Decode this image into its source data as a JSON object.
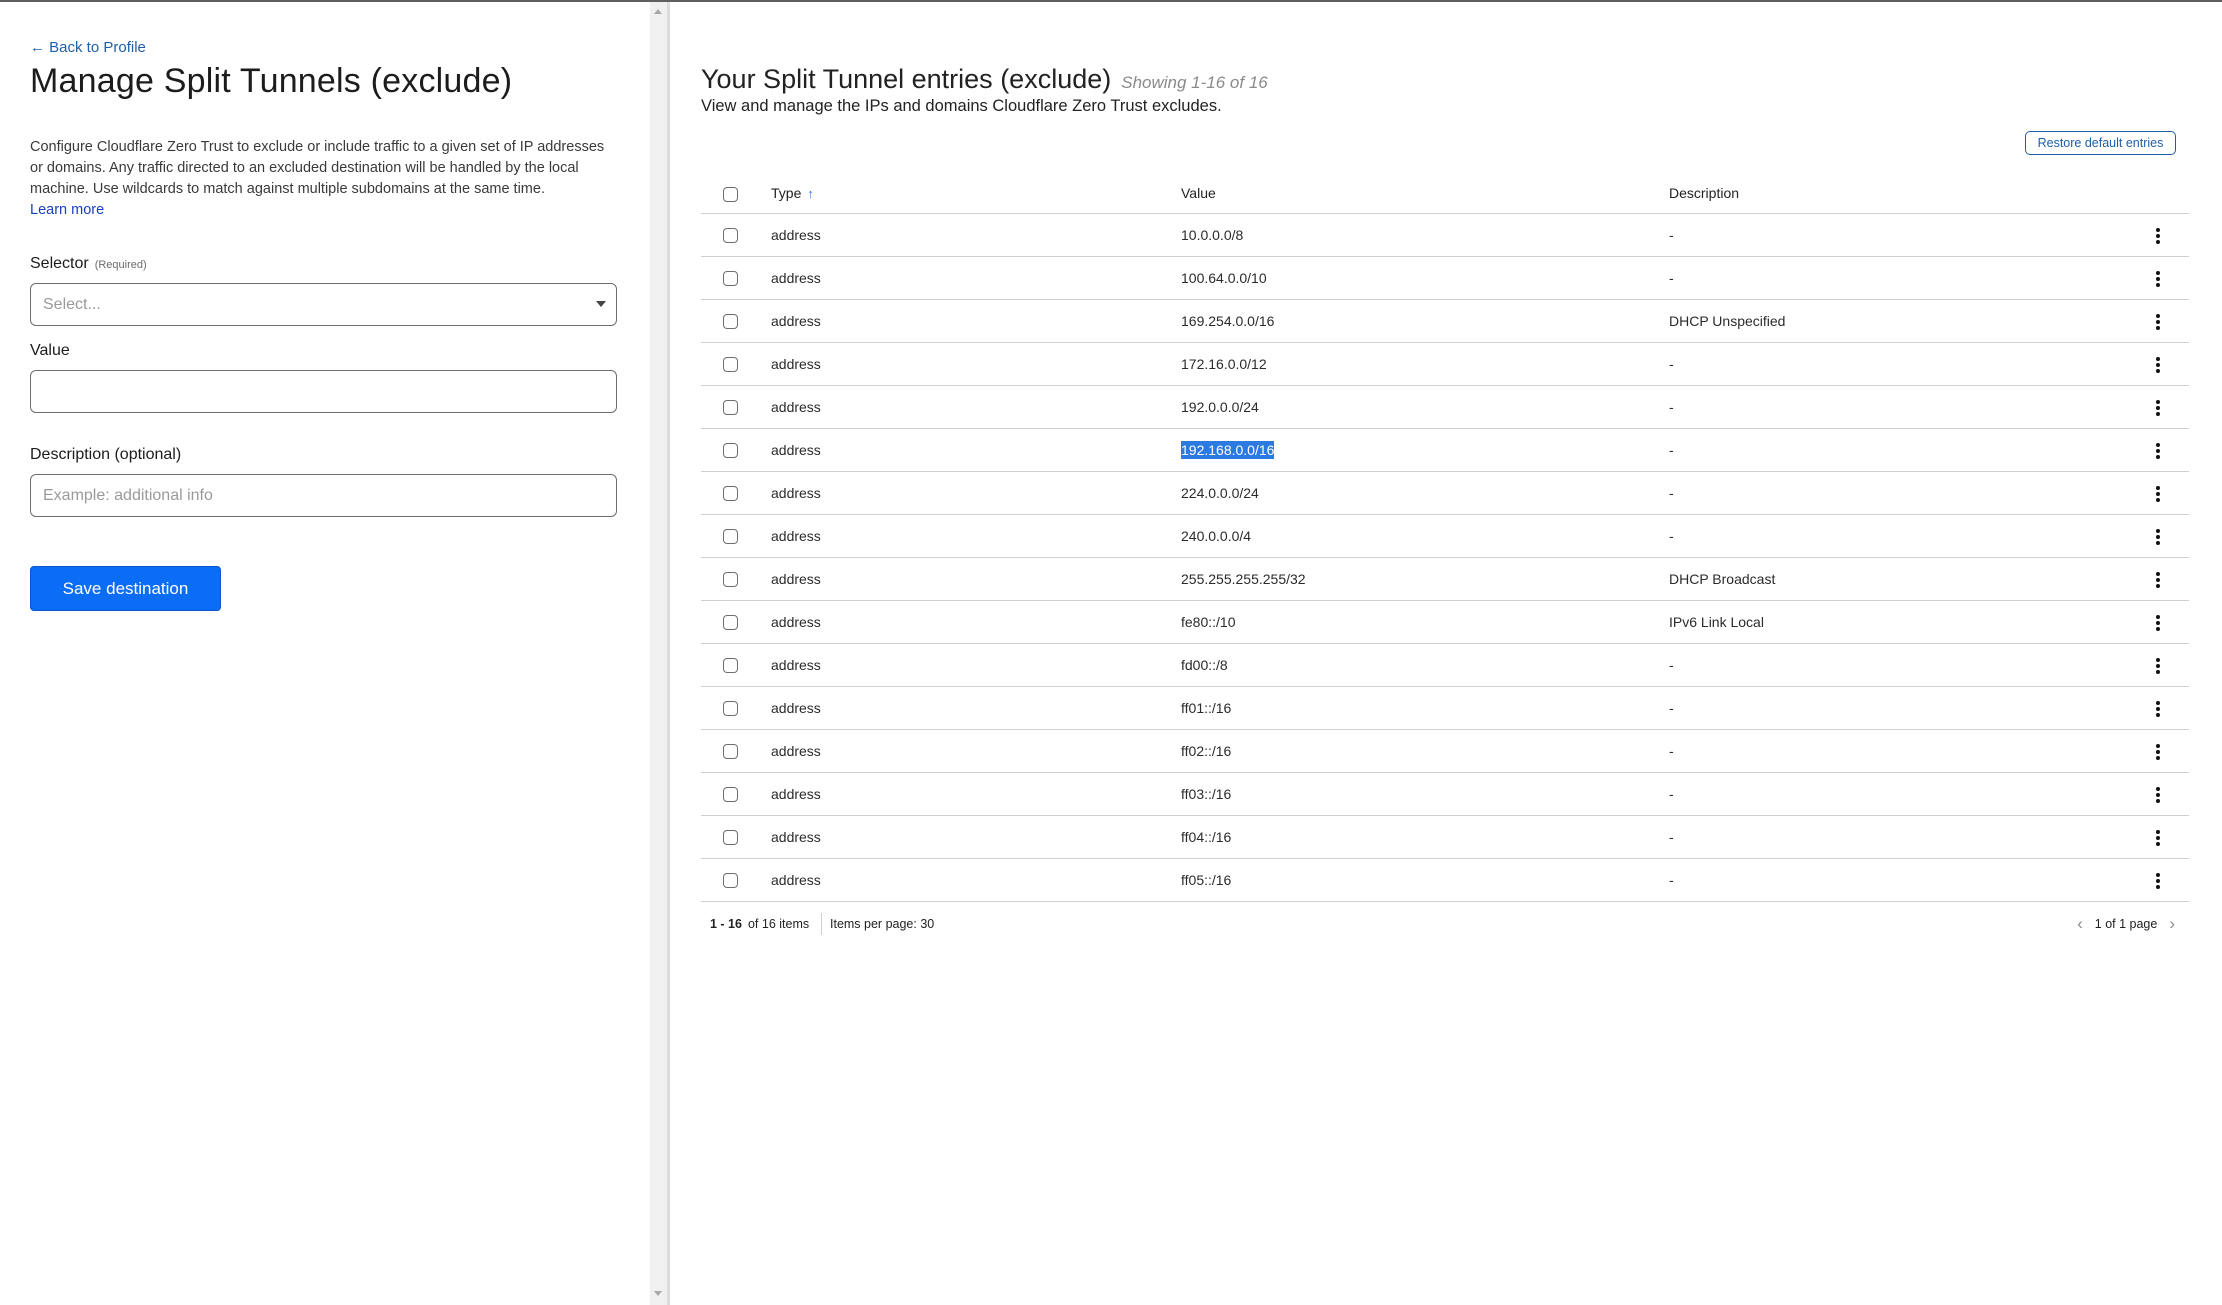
{
  "left_panel": {
    "back_link": "← Back to Profile",
    "title": "Manage Split Tunnels (exclude)",
    "intro": "Configure Cloudflare Zero Trust to exclude or include traffic to a given set of IP addresses or domains. Any traffic directed to an excluded destination will be handled by the local machine. Use wildcards to match against multiple subdomains at the same time.",
    "learn_more": "Learn more",
    "selector": {
      "label": "Selector",
      "required": "(Required)",
      "placeholder": "Select..."
    },
    "value": {
      "label": "Value",
      "value": "",
      "placeholder": ""
    },
    "description": {
      "label": "Description (optional)",
      "value": "",
      "placeholder": "Example: additional info"
    },
    "save_button": "Save destination"
  },
  "right_panel": {
    "title": "Your Split Tunnel entries (exclude)",
    "showing": "Showing 1-16 of 16",
    "subtitle": "View and manage the IPs and domains Cloudflare Zero Trust excludes.",
    "restore_button": "Restore default entries",
    "table": {
      "columns": [
        "Type",
        "Value",
        "Description"
      ],
      "sort_indicator": "↑",
      "rows": [
        {
          "type": "address",
          "value": "10.0.0.0/8",
          "description": "-"
        },
        {
          "type": "address",
          "value": "100.64.0.0/10",
          "description": "-"
        },
        {
          "type": "address",
          "value": "169.254.0.0/16",
          "description": "DHCP Unspecified"
        },
        {
          "type": "address",
          "value": "172.16.0.0/12",
          "description": "-"
        },
        {
          "type": "address",
          "value": "192.0.0.0/24",
          "description": "-"
        },
        {
          "type": "address",
          "value": "192.168.0.0/16",
          "description": "-",
          "selected_text": true
        },
        {
          "type": "address",
          "value": "224.0.0.0/24",
          "description": "-"
        },
        {
          "type": "address",
          "value": "240.0.0.0/4",
          "description": "-"
        },
        {
          "type": "address",
          "value": "255.255.255.255/32",
          "description": "DHCP Broadcast"
        },
        {
          "type": "address",
          "value": "fe80::/10",
          "description": "IPv6 Link Local"
        },
        {
          "type": "address",
          "value": "fd00::/8",
          "description": "-"
        },
        {
          "type": "address",
          "value": "ff01::/16",
          "description": "-"
        },
        {
          "type": "address",
          "value": "ff02::/16",
          "description": "-"
        },
        {
          "type": "address",
          "value": "ff03::/16",
          "description": "-"
        },
        {
          "type": "address",
          "value": "ff04::/16",
          "description": "-"
        },
        {
          "type": "address",
          "value": "ff05::/16",
          "description": "-"
        }
      ]
    },
    "footer": {
      "range": "1 - 16",
      "of_items": "of 16 items",
      "items_per_page": "Items per page: 30",
      "page_status": "1 of 1 page",
      "prev_icon": "chevron-left-icon",
      "next_icon": "chevron-right-icon"
    }
  },
  "colors": {
    "primary_button": "#0b6cf5",
    "link": "#1f5fa8",
    "selection": "#2a7ae2",
    "sort_arrow": "#2a7ad8"
  }
}
